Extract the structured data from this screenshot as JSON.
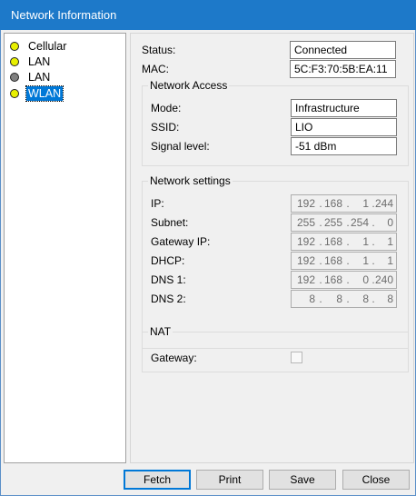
{
  "window": {
    "title": "Network Information"
  },
  "tree": {
    "items": [
      {
        "label": "Cellular",
        "color": "#e8f000",
        "selected": false
      },
      {
        "label": "LAN",
        "color": "#e8f000",
        "selected": false
      },
      {
        "label": "LAN",
        "color": "#808080",
        "selected": false
      },
      {
        "label": "WLAN",
        "color": "#e8f000",
        "selected": true
      }
    ]
  },
  "status": {
    "label": "Status:",
    "value": "Connected"
  },
  "mac": {
    "label": "MAC:",
    "value": "5C:F3:70:5B:EA:11"
  },
  "network_access": {
    "legend": "Network Access",
    "mode": {
      "label": "Mode:",
      "value": "Infrastructure"
    },
    "ssid": {
      "label": "SSID:",
      "value": "LIO"
    },
    "signal": {
      "label": "Signal level:",
      "value": "-51 dBm"
    }
  },
  "network_settings": {
    "legend": "Network settings",
    "ip": {
      "label": "IP:",
      "octets": [
        "192",
        "168",
        "1",
        "244"
      ]
    },
    "subnet": {
      "label": "Subnet:",
      "octets": [
        "255",
        "255",
        "254",
        "0"
      ]
    },
    "gateway": {
      "label": "Gateway IP:",
      "octets": [
        "192",
        "168",
        "1",
        "1"
      ]
    },
    "dhcp": {
      "label": "DHCP:",
      "octets": [
        "192",
        "168",
        "1",
        "1"
      ]
    },
    "dns1": {
      "label": "DNS 1:",
      "octets": [
        "192",
        "168",
        "0",
        "240"
      ]
    },
    "dns2": {
      "label": "DNS 2:",
      "octets": [
        "8",
        "8",
        "8",
        "8"
      ]
    }
  },
  "nat": {
    "legend": "NAT",
    "gateway": {
      "label": "Gateway:",
      "checked": false
    }
  },
  "buttons": {
    "fetch": "Fetch",
    "print": "Print",
    "save": "Save",
    "close": "Close"
  },
  "colors": {
    "titlebar": "#1d79c9",
    "selection": "#0078d7",
    "status_dot_active": "#e8f000",
    "status_dot_inactive": "#808080"
  }
}
